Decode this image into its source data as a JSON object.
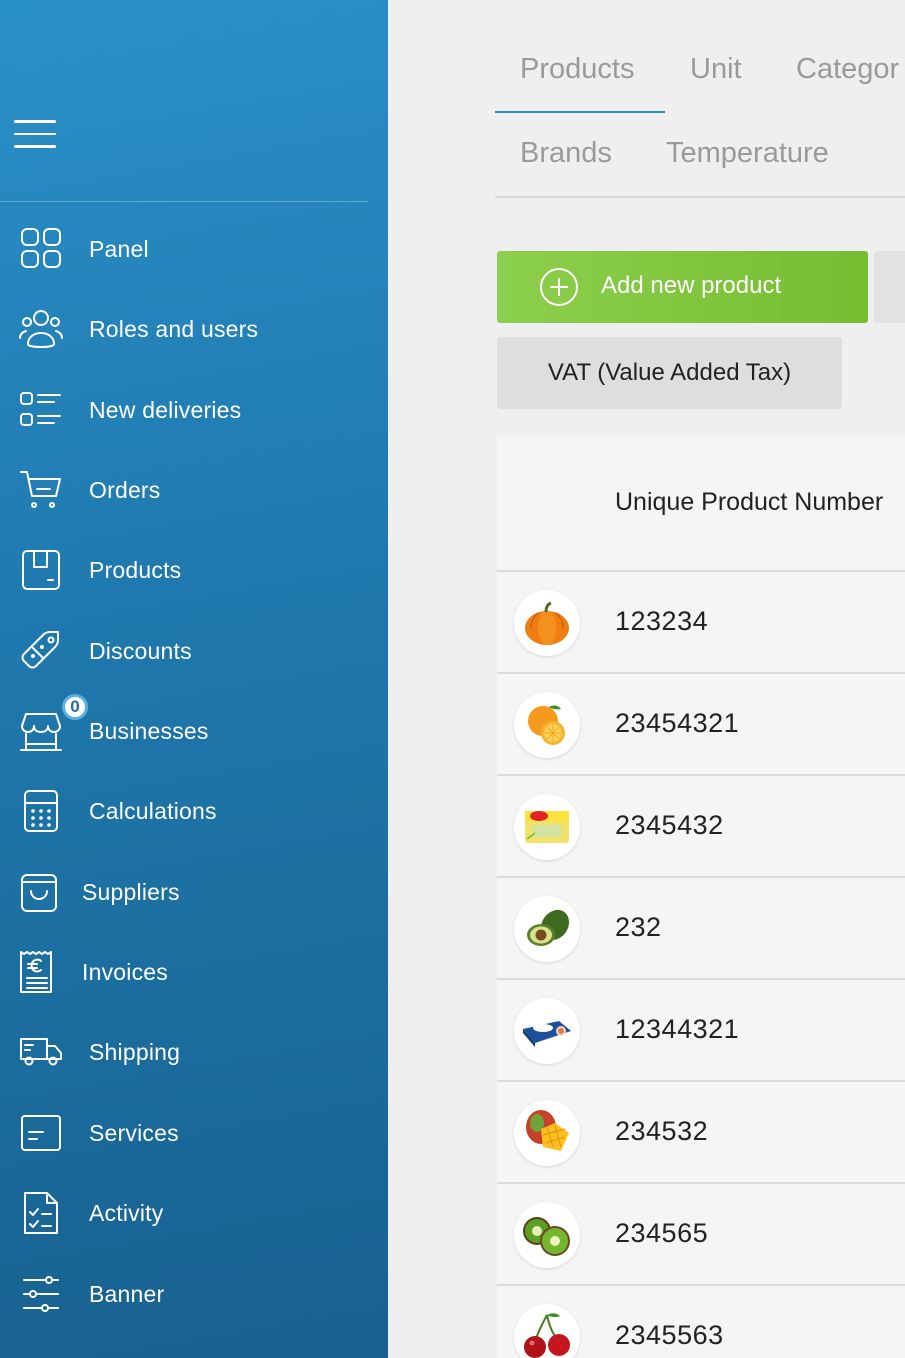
{
  "sidebar": {
    "items": [
      {
        "label": "Panel",
        "icon": "grid-icon"
      },
      {
        "label": "Roles and users",
        "icon": "users-icon"
      },
      {
        "label": "New deliveries",
        "icon": "list-icon"
      },
      {
        "label": "Orders",
        "icon": "cart-icon"
      },
      {
        "label": "Products",
        "icon": "box-icon"
      },
      {
        "label": "Discounts",
        "icon": "tag-icon"
      },
      {
        "label": "Businesses",
        "icon": "store-icon",
        "badge": "0"
      },
      {
        "label": "Calculations",
        "icon": "calculator-icon"
      },
      {
        "label": "Suppliers",
        "icon": "bag-icon"
      },
      {
        "label": "Invoices",
        "icon": "euro-receipt-icon"
      },
      {
        "label": "Shipping",
        "icon": "truck-icon"
      },
      {
        "label": "Services",
        "icon": "card-icon"
      },
      {
        "label": "Activity",
        "icon": "checklist-icon"
      },
      {
        "label": "Banner",
        "icon": "sliders-icon"
      }
    ]
  },
  "tabs": {
    "products": "Products",
    "unit": "Unit",
    "categories": "Categor",
    "brands": "Brands",
    "temperature": "Temperature"
  },
  "actions": {
    "add_label": "Add new product",
    "vat_label": "VAT (Value Added Tax)"
  },
  "table": {
    "column_header": "Unique Product Number",
    "rows": [
      {
        "number": "123234",
        "image": "pumpkin"
      },
      {
        "number": "23454321",
        "image": "oranges"
      },
      {
        "number": "2345432",
        "image": "tea-box"
      },
      {
        "number": "232",
        "image": "avocado"
      },
      {
        "number": "12344321",
        "image": "butter-pack"
      },
      {
        "number": "234532",
        "image": "mango"
      },
      {
        "number": "234565",
        "image": "kiwi"
      },
      {
        "number": "2345563",
        "image": "cherries"
      }
    ]
  },
  "colors": {
    "sidebar_top": "#2a90c8",
    "sidebar_bottom": "#18618f",
    "accent_green": "#7ec23a",
    "tab_underline": "#2a8fc8"
  }
}
